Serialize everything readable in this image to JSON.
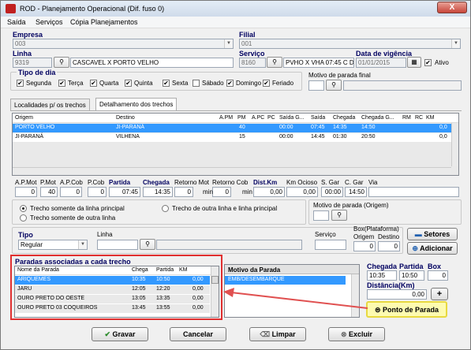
{
  "window": {
    "title": "ROD - Planejamento Operacional (Dif. fuso 0)",
    "close_label": "X"
  },
  "menu": [
    "Saída",
    "Serviços",
    "Cópia Planejamentos"
  ],
  "header": {
    "empresa_label": "Empresa",
    "empresa_value": "003",
    "filial_label": "Filial",
    "filial_value": "001",
    "linha_label": "Linha",
    "linha_code": "9319",
    "linha_name": "CASCAVEL X PORTO VELHO",
    "servico_label": "Serviço",
    "servico_code": "8160",
    "servico_desc": "PVHO X VHA 07:45 C D",
    "vigencia_label": "Data de vigência",
    "vigencia_value": "01/01/2015",
    "ativo_label": "Ativo"
  },
  "tipo_dia": {
    "title": "Tipo de dia",
    "days": [
      "Segunda",
      "Terça",
      "Quarta",
      "Quinta",
      "Sexta",
      "Sábado",
      "Domingo",
      "Feriado"
    ],
    "checked": [
      true,
      true,
      true,
      true,
      true,
      false,
      true,
      true
    ]
  },
  "motivo_parada_final": {
    "label": "Motivo de parada final"
  },
  "tabs": [
    "Localidades p/ os trechos",
    "Detalhamento dos trechos"
  ],
  "trechos": {
    "columns": [
      "Origem",
      "Destino",
      "A.PM",
      "PM",
      "A.PC",
      "PC",
      "Saída G...",
      "Saída",
      "Chegada",
      "Chegada G...",
      "RM",
      "RC",
      "KM"
    ],
    "rows": [
      {
        "origem": "PORTO VELHO",
        "destino": "JI-PARANÁ",
        "pm": "40",
        "saida_g": "00:00",
        "saida": "07:45",
        "chegada": "14:35",
        "chegada_g": "14:50",
        "km": "0,0"
      },
      {
        "origem": "JI-PARANÁ",
        "destino": "VILHENA",
        "pm": "15",
        "saida_g": "00:00",
        "saida": "14:45",
        "chegada": "01:30",
        "chegada_g": "20:50",
        "km": "0,0"
      }
    ]
  },
  "detalhe": {
    "labels": [
      "A.P.Mot",
      "P.Mot",
      "A.P.Cob",
      "P.Cob",
      "Partida",
      "Chegada",
      "Retorno Mot",
      "Retorno Cob",
      "Dist.Km",
      "Km Ocioso",
      "S. Gar",
      "C. Gar",
      "Via"
    ],
    "values": [
      "0",
      "40",
      "0",
      "0",
      "07:45",
      "14:35",
      "0",
      "0",
      "0,00",
      "0,00",
      "00:00",
      "14:50",
      ""
    ],
    "min_label": "min"
  },
  "opcoes": {
    "r1": "Trecho somente da linha principal",
    "r2": "Trecho somente de outra linha",
    "r3": "Trecho de outra linha e linha principal",
    "motivo_origem_label": "Motivo de parada (Origem)"
  },
  "filtro": {
    "tipo_label": "Tipo",
    "tipo_value": "Regular",
    "linha_label": "Linha",
    "servico_label": "Serviço",
    "box_label": "Box(Plataforma)",
    "origem_label": "Origem",
    "destino_label": "Destino",
    "origem_value": "0",
    "destino_value": "0",
    "setores_label": "Setores",
    "adicionar_label": "Adicionar"
  },
  "paradas": {
    "title": "Paradas associadas a cada trecho",
    "columns": [
      "Nome da Parada",
      "Chega",
      "Partida",
      "KM"
    ],
    "rows": [
      {
        "nome": "ARIQUEMES",
        "chega": "10:35",
        "partida": "10:50",
        "km": "0,00"
      },
      {
        "nome": "JARU",
        "chega": "12:05",
        "partida": "12:20",
        "km": "0,00"
      },
      {
        "nome": "OURO PRETO DO OESTE",
        "chega": "13:05",
        "partida": "13:35",
        "km": "0,00"
      },
      {
        "nome": "OURO PRETO 03 COQUEIROS",
        "chega": "13:45",
        "partida": "13:55",
        "km": "0,00"
      }
    ]
  },
  "motivo": {
    "title": "Motivo da Parada",
    "value": "EMB/DESEMBARQUE"
  },
  "parada_edit": {
    "chegada_label": "Chegada",
    "partida_label": "Partida",
    "box_label": "Box",
    "chegada_value": "10:35",
    "partida_value": "10:50",
    "box_value": "0",
    "distancia_label": "Distância(Km)",
    "distancia_value": "0,00",
    "plus_label": "+",
    "ponto_label": "Ponto de Parada"
  },
  "footer": {
    "gravar": "Gravar",
    "cancelar": "Cancelar",
    "limpar": "Limpar",
    "excluir": "Excluir"
  }
}
